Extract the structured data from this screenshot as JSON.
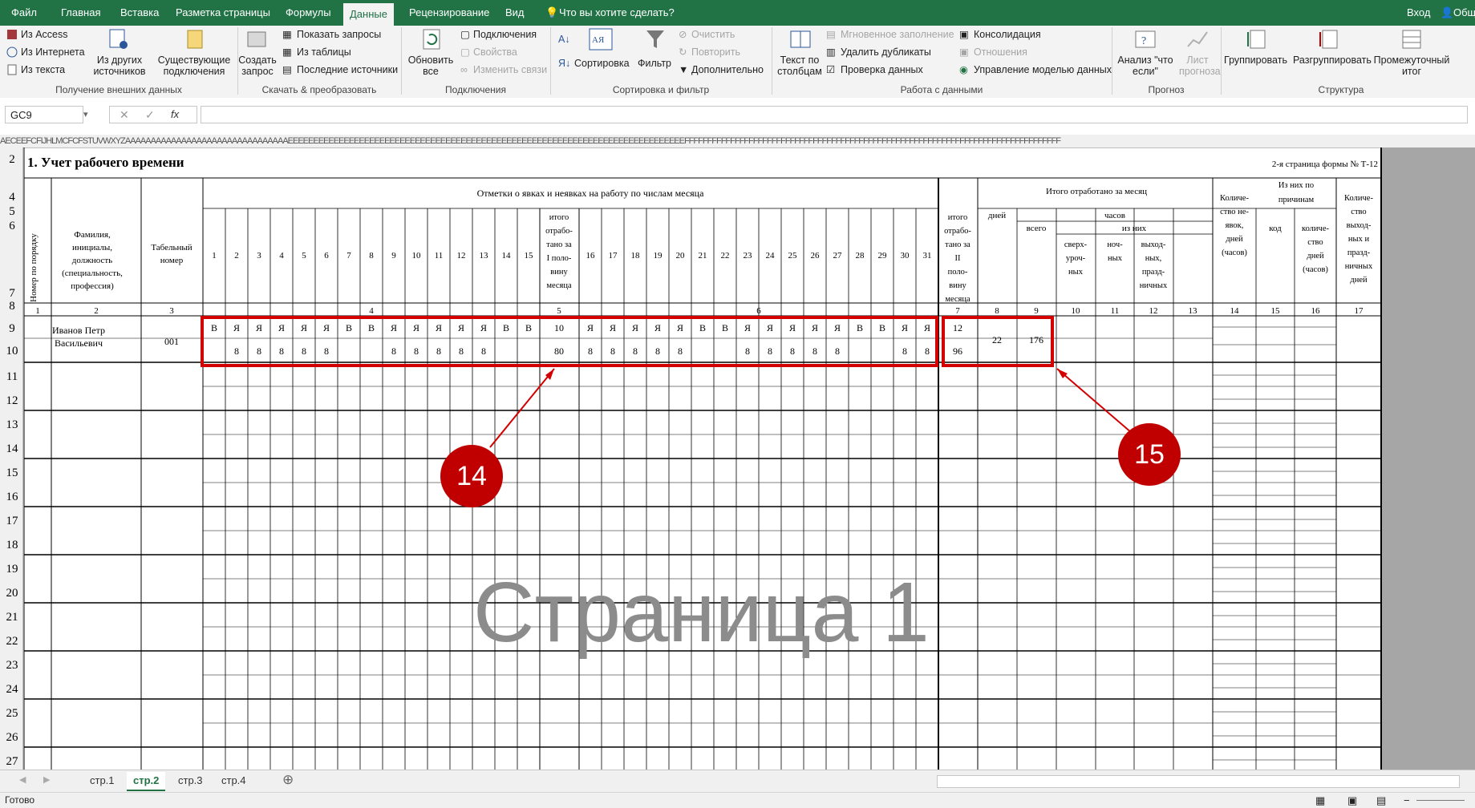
{
  "menu_tabs": [
    "Файл",
    "Главная",
    "Вставка",
    "Разметка страницы",
    "Формулы",
    "Данные",
    "Рецензирование",
    "Вид"
  ],
  "active_tab": "Данные",
  "tell_me": "Что вы хотите сделать?",
  "login": "Вход",
  "share": "Общ",
  "ribbon": {
    "groups": [
      "Получение внешних данных",
      "Скачать & преобразовать",
      "Подключения",
      "Сортировка и фильтр",
      "Работа с данными",
      "Прогноз",
      "Структура"
    ],
    "from_access": "Из Access",
    "from_web": "Из Интернета",
    "from_text": "Из текста",
    "from_other": "Из других источников",
    "existing": "Существующие подключения",
    "new_query": "Создать запрос",
    "show_queries": "Показать запросы",
    "from_table": "Из таблицы",
    "recent": "Последние источники",
    "refresh_all": "Обновить все",
    "connections": "Подключения",
    "properties": "Свойства",
    "edit_links": "Изменить связи",
    "sort_az": "АЯ",
    "sort": "Сортировка",
    "filter": "Фильтр",
    "clear": "Очистить",
    "reapply": "Повторить",
    "advanced": "Дополнительно",
    "text_to_cols": "Текст по столбцам",
    "flash_fill": "Мгновенное заполнение",
    "remove_dups": "Удалить дубликаты",
    "validation": "Проверка данных",
    "consolidate": "Консолидация",
    "relations": "Отношения",
    "data_model": "Управление моделью данных",
    "whatif": "Анализ \"что если\"",
    "forecast": "Лист прогноза",
    "group": "Группировать",
    "ungroup": "Разгруппировать",
    "subtotal": "Промежуточный итог"
  },
  "formula_bar": {
    "name_box": "GC9",
    "fx": "fx",
    "value": ""
  },
  "col_header_strip": "AECEEFCFIJHLMCFCFSTUVWXYZAAAAAAAAAAAAAAAAAAAAAAAAAAAAAAAAEEEEEEEEEEEEEEEEEEEEEEEEEEEEEEEEEEEEEEEEEEEEEEEEEEEEEEEEEEEEEEEEEEEEEEEEEEEEEEFFFFFFFFFFFFFFFFFFFFFFFFFFFFFFFFFFFFFFFFFFFFFFFFFFFFFFFFFFFFFFFFFFFFFFFFFFFFFFFFFF",
  "sheet": {
    "title": "1. Учет рабочего времени",
    "form_note": "2-я страница формы № Т-12",
    "headers": {
      "num": "Номер по порядку",
      "name": "Фамилия, инициалы, должность (специальность, профессия)",
      "tab": "Табельный номер",
      "marks": "Отметки о явках и неявках на работу по числам месяца",
      "half1": "итого отрабо- тано за I поло- вину месяца",
      "half2": "итого отрабо- тано за II поло- вину месяца",
      "total": "Итого отработано за месяц",
      "days": "дней",
      "hours": "часов",
      "all": "всего",
      "of_which": "из них",
      "overtime": "сверх- уроч- ных",
      "night": "ноч- ных",
      "weekend": "выход- ных, празд- ничных",
      "absence_cnt": "Количе- ство не- явок, дней (часов)",
      "reasons": "Из них по причинам",
      "code": "код",
      "cnt_days": "количе- ство дней (часов)",
      "holidays": "Количе- ство выход- ных и празд- ничных дней"
    },
    "days_first": [
      "1",
      "2",
      "3",
      "4",
      "5",
      "6",
      "7",
      "8",
      "9",
      "10",
      "11",
      "12",
      "13",
      "14",
      "15"
    ],
    "days_second": [
      "16",
      "17",
      "18",
      "19",
      "20",
      "21",
      "22",
      "23",
      "24",
      "25",
      "26",
      "27",
      "28",
      "29",
      "30",
      "31"
    ],
    "col_numbers": [
      "1",
      "2",
      "3",
      "4",
      "5",
      "6",
      "7",
      "8",
      "9",
      "10",
      "11",
      "12",
      "13",
      "14",
      "15",
      "16",
      "17"
    ],
    "employee": {
      "name": "Иванов Петр Васильевич",
      "tab_num": "001",
      "marks_first": [
        "В",
        "Я",
        "Я",
        "Я",
        "Я",
        "Я",
        "В",
        "В",
        "Я",
        "Я",
        "Я",
        "Я",
        "Я",
        "В",
        "В"
      ],
      "hours_first": [
        "",
        "8",
        "8",
        "8",
        "8",
        "8",
        "",
        "",
        "8",
        "8",
        "8",
        "8",
        "8",
        "",
        ""
      ],
      "half1_days": "10",
      "half1_hours": "80",
      "marks_second": [
        "Я",
        "Я",
        "Я",
        "Я",
        "Я",
        "В",
        "В",
        "Я",
        "Я",
        "Я",
        "Я",
        "Я",
        "В",
        "В",
        "Я",
        "Я"
      ],
      "hours_second": [
        "8",
        "8",
        "8",
        "8",
        "8",
        "",
        "",
        "8",
        "8",
        "8",
        "8",
        "8",
        "",
        "",
        "8",
        "8"
      ],
      "half2_days": "12",
      "half2_hours": "96",
      "total_days": "22",
      "total_hours": "176"
    },
    "row_numbers": [
      "2",
      "4",
      "5",
      "6",
      "7",
      "8",
      "9",
      "10",
      "11",
      "12",
      "13",
      "14",
      "15",
      "16",
      "17",
      "18",
      "19",
      "20",
      "21",
      "22",
      "23",
      "24",
      "25",
      "26",
      "27"
    ],
    "watermark": "Страница 1"
  },
  "callouts": [
    "14",
    "15"
  ],
  "sheet_tabs": [
    "стр.1",
    "стр.2",
    "стр.3",
    "стр.4"
  ],
  "active_sheet": "стр.2",
  "status": "Готово",
  "colors": {
    "excel_green": "#217346",
    "highlight_red": "#d40000",
    "badge_red": "#c00000"
  }
}
